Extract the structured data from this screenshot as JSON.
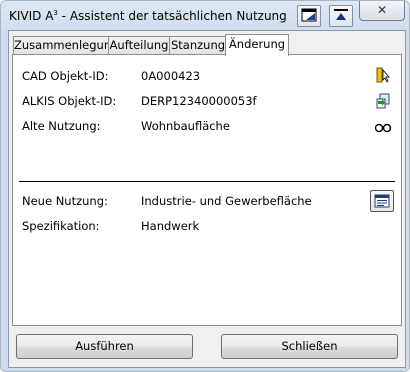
{
  "window": {
    "title": "KIVID A",
    "title_superscript": "3",
    "title_suffix": " - Assistent der tatsächlichen Nutzung",
    "close_glyph": "✕"
  },
  "tabs": [
    {
      "label": "Zusammenlegung",
      "active": false
    },
    {
      "label": "Aufteilung",
      "active": false
    },
    {
      "label": "Stanzung",
      "active": false
    },
    {
      "label": "Änderung",
      "active": true
    }
  ],
  "fields": {
    "cad_id": {
      "label": "CAD Objekt-ID:",
      "value": "0A000423"
    },
    "alkis_id": {
      "label": "ALKIS Objekt-ID:",
      "value": "DERP12340000053f"
    },
    "old_usage": {
      "label": "Alte Nutzung:",
      "value": "Wohnbaufläche"
    },
    "new_usage": {
      "label": "Neue Nutzung:",
      "value": "Industrie- und Gewerbefläche"
    },
    "specification": {
      "label": "Spezifikation:",
      "value": "Handwerk"
    }
  },
  "buttons": {
    "execute": "Ausführen",
    "close": "Schließen"
  },
  "icons": {
    "select_object": "select-object-icon",
    "copy_id": "copy-id-icon",
    "view": "view-glasses-icon",
    "choose_usage": "choose-usage-icon"
  }
}
